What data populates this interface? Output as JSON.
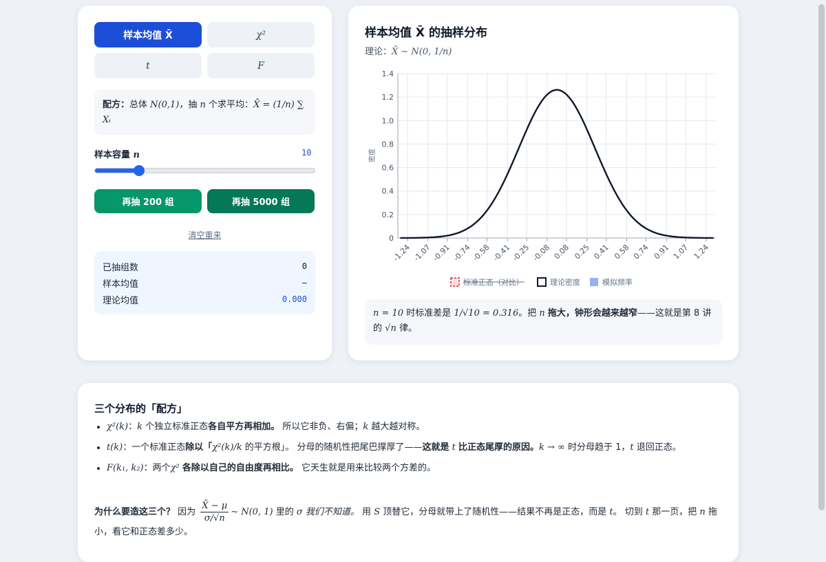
{
  "tabs": [
    {
      "label": "样本均值 X̄",
      "active": true
    },
    {
      "label": "χ²",
      "active": false
    },
    {
      "label": "t",
      "active": false
    },
    {
      "label": "F",
      "active": false
    }
  ],
  "recipe": {
    "label": "配方：",
    "text_a": "总体",
    "math_pop": "N(0,1)",
    "text_b": "，抽",
    "math_n": "n",
    "text_c": "个求平均：",
    "math_formula": "X̄ = (1/n) ∑ Xᵢ"
  },
  "slider": {
    "label": "样本容量",
    "var": "n",
    "value": "10",
    "fraction": 0.2
  },
  "buttons": {
    "draw200": "再抽 200 组",
    "draw5000": "再抽 5000 组",
    "reset": "清空重来"
  },
  "colors": {
    "draw200": "#059669",
    "draw5000": "#047857",
    "accent": "#1d4ed8",
    "curve": "#0f172a",
    "sim": "#93b4ee",
    "normal": "#dc2626"
  },
  "stats": [
    {
      "label": "已抽组数",
      "value": "0"
    },
    {
      "label": "样本均值",
      "value": "–"
    },
    {
      "label": "理论均值",
      "value": "0.000"
    }
  ],
  "chart_panel": {
    "title": "样本均值 X̄ 的抽样分布",
    "subtitle_label": "理论：",
    "subtitle_math": "X̄ ∼ N(0, 1/n)"
  },
  "chart_data": {
    "type": "line",
    "ylabel": "密度",
    "xlabel": "",
    "ylim": [
      0,
      1.4
    ],
    "yticks": [
      "0",
      "0.2",
      "0.4",
      "0.6",
      "0.8",
      "1.0",
      "1.2",
      "1.4"
    ],
    "categories": [
      "-1.24",
      "-1.07",
      "-0.91",
      "-0.74",
      "-0.58",
      "-0.41",
      "-0.25",
      "-0.08",
      "0.08",
      "0.25",
      "0.41",
      "0.58",
      "0.74",
      "0.91",
      "1.07",
      "1.24"
    ],
    "grid": true,
    "legend_position": "bottom",
    "legend": [
      "标准正态（对比）",
      "理论密度",
      "模拟频率"
    ],
    "series": [
      {
        "name": "理论密度",
        "x": [
          -1.24,
          -1.07,
          -0.91,
          -0.74,
          -0.58,
          -0.41,
          -0.25,
          -0.08,
          0,
          0.08,
          0.25,
          0.41,
          0.58,
          0.74,
          0.91,
          1.07,
          1.24
        ],
        "values": [
          0.001,
          0.004,
          0.02,
          0.08,
          0.23,
          0.54,
          0.92,
          1.22,
          1.26,
          1.22,
          0.92,
          0.54,
          0.23,
          0.08,
          0.02,
          0.004,
          0.001
        ]
      },
      {
        "name": "标准正态（对比）",
        "hidden": true,
        "values": []
      },
      {
        "name": "模拟频率",
        "values": []
      }
    ]
  },
  "note": {
    "m1": "n = 10",
    "t1": "时标准差是",
    "m2": "1/√10 = 0.316",
    "t2": "。把",
    "m3": "n",
    "b1": "拖大，钟形会越来越窄",
    "t3": "——这就是第 8 讲的",
    "m4": "√n",
    "t4": "律。"
  },
  "bottom": {
    "title": "三个分布的「配方」",
    "items": [
      {
        "math": "χ²(k)",
        "t1": "：",
        "m2": "k",
        "t2": "个独立标准正态",
        "b": "各自平方再相加。",
        "t3": "所以它非负、右偏；",
        "m3": "k",
        "t4": "越大越对称。"
      },
      {
        "math": "t(k)",
        "t1": "：一个标准正态",
        "b": "除以「",
        "m2": "χ²(k)/k",
        "t2": "的平方根」",
        "t3": "。 分母的随机性把尾巴撑厚了——",
        "b2": "这就是",
        "m3": "t",
        "b3": "比正态尾厚的原因。",
        "m4": "k → ∞",
        "t4": "时分母趋于 1，",
        "m5": "t",
        "t5": "退回正态。"
      },
      {
        "math": "F(k₁, k₂)",
        "t1": "：两个",
        "m2": "χ²",
        "b": "各除以自己的自由度再相比。",
        "t2": "它天生就是用来比较两个方差的。"
      }
    ],
    "why": {
      "b": "为什么要造这三个？",
      "t1": "因为",
      "frac_num": "X̄ − μ",
      "frac_den": "σ/√n",
      "m1": "∼ N(0, 1)",
      "t2": "里的",
      "m2": "σ",
      "i": "我们不知道。",
      "t3": "用",
      "m3": "S",
      "t4": "顶替它，分母就带上了随机性——结果不再是正态，而是",
      "m4": "t",
      "t5": "。 切到",
      "m5": "t",
      "t6": "那一页，把",
      "m6": "n",
      "t7": "拖小，看它和正态差多少。"
    }
  }
}
